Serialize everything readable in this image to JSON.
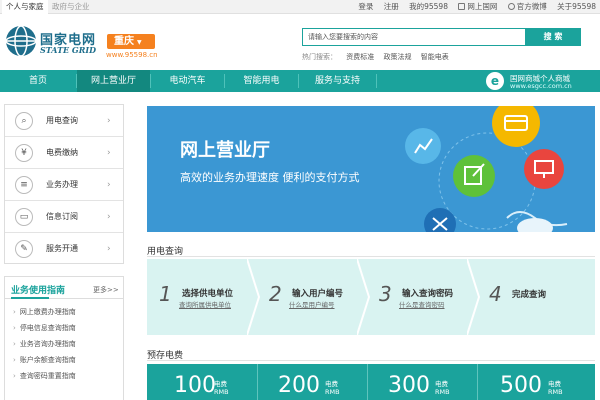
{
  "topbar": {
    "tab_personal": "个人与家庭",
    "tab_enterprise": "政府与企业",
    "links": [
      "登录",
      "注册",
      "我的95598",
      "网上国网",
      "官方微博",
      "关于95598"
    ]
  },
  "header": {
    "brand_cn": "国家电网",
    "brand_en": "STATE GRID",
    "city": "重庆",
    "site_url": "www.95598.cn",
    "search_placeholder": "请输入您要搜索的内容",
    "search_button": "搜 索",
    "hot_label": "热门搜索：",
    "hot_keywords": [
      "资费标准",
      "政策法规",
      "智能电表"
    ]
  },
  "nav": {
    "items": [
      "首页",
      "网上营业厅",
      "电动汽车",
      "智能用电",
      "服务与支持"
    ],
    "active_index": 1,
    "mall_title": "国网商城个人商城",
    "mall_url": "www.esgcc.com.cn"
  },
  "sidebar": {
    "items": [
      {
        "label": "用电查询",
        "icon": "search-chart-icon"
      },
      {
        "label": "电费缴纳",
        "icon": "coin-icon"
      },
      {
        "label": "业务办理",
        "icon": "document-icon"
      },
      {
        "label": "信息订阅",
        "icon": "monitor-icon"
      },
      {
        "label": "服务开通",
        "icon": "edit-icon"
      }
    ],
    "active_index": 0
  },
  "guide": {
    "title": "业务使用指南",
    "more": "更多>>",
    "items": [
      "网上缴费办理指南",
      "停电信息查询指南",
      "业务咨询办理指南",
      "账户余额查询指南",
      "查询密码重置指南"
    ]
  },
  "banner": {
    "title": "网上营业厅",
    "subtitle": "高效的业务办理速度   便利的支付方式"
  },
  "query": {
    "section_title": "用电查询",
    "steps": [
      {
        "num": "1",
        "main": "选择供电单位",
        "sub": "查询所属供电单位"
      },
      {
        "num": "2",
        "main": "输入用户编号",
        "sub": "什么是用户编号"
      },
      {
        "num": "3",
        "main": "输入查询密码",
        "sub": "什么是查询密码"
      },
      {
        "num": "4",
        "main": "完成查询",
        "sub": ""
      }
    ]
  },
  "prepay": {
    "section_title": "预存电费",
    "unit_top": "电费",
    "unit_bottom": "RMB",
    "amounts": [
      "100",
      "200",
      "300",
      "500"
    ]
  },
  "colors": {
    "brand_teal": "#1ba39c",
    "nav_active": "#13887f",
    "city_orange": "#f5811f",
    "banner_blue": "#3b97d3",
    "steps_bg": "#d9f3f1"
  }
}
